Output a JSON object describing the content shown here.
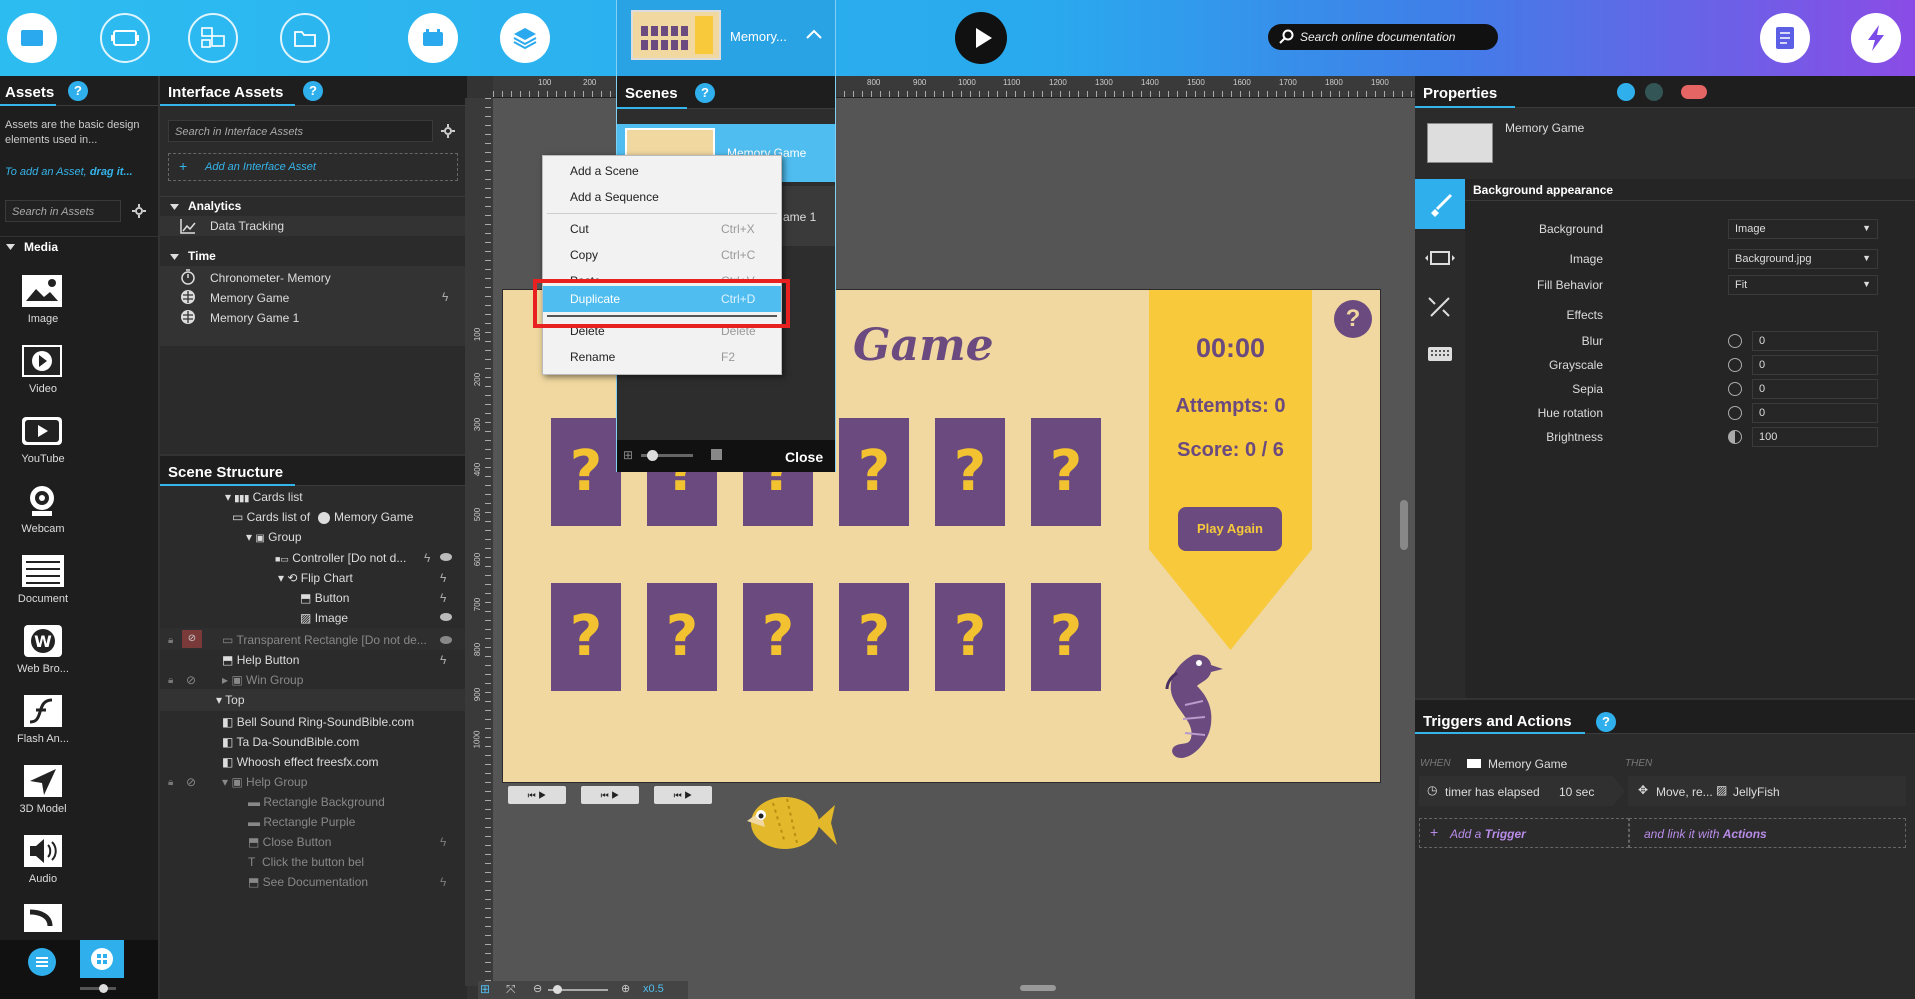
{
  "topbar": {
    "scene_selector_label": "Memory...",
    "doc_search_placeholder": "Search online documentation"
  },
  "assets": {
    "title": "Assets",
    "help": "?",
    "description": "Assets are the basic design elements used in...",
    "add_hint_prefix": "To add an Asset,",
    "add_hint_action": "drag it...",
    "search_placeholder": "Search in Assets",
    "media_group": "Media",
    "items": [
      "Image",
      "Video",
      "YouTube",
      "Webcam",
      "Document",
      "Web Bro...",
      "Flash An...",
      "3D Model",
      "Audio"
    ]
  },
  "interface_assets": {
    "title": "Interface Assets",
    "help": "?",
    "search_placeholder": "Search in Interface Assets",
    "add_label": "Add an Interface Asset",
    "groups": [
      {
        "name": "Analytics",
        "items": [
          "Data Tracking"
        ]
      },
      {
        "name": "Time",
        "items": [
          "Chronometer- Memory",
          "Memory Game",
          "Memory Game 1"
        ]
      }
    ]
  },
  "scene_structure": {
    "title": "Scene Structure",
    "rows": [
      "Cards list",
      "Cards list of",
      "Memory Game",
      "Group",
      "Controller [Do not d...",
      "Flip Chart",
      "Button",
      "Image",
      "Transparent Rectangle [Do not de...",
      "Help Button",
      "Win Group",
      "Top",
      "Bell Sound Ring-SoundBible.com",
      "Ta Da-SoundBible.com",
      "Whoosh effect freesfx.com",
      "Help Group",
      "Rectangle Background",
      "Rectangle Purple",
      "Close Button",
      "Click the button bel",
      "See Documentation"
    ]
  },
  "ruler_top": [
    "100",
    "200",
    "800",
    "900",
    "1000",
    "1100",
    "1200",
    "1300",
    "1400",
    "1500",
    "1600",
    "1700",
    "1800",
    "1900"
  ],
  "ruler_left": [
    "100",
    "200",
    "300",
    "400",
    "500",
    "600",
    "700",
    "800",
    "900",
    "1000"
  ],
  "scenes": {
    "title": "Scenes",
    "help": "?",
    "items": [
      "Memory Game",
      "Memory Game 1"
    ],
    "close_label": "Close"
  },
  "context_menu": {
    "items": [
      {
        "label": "Add a Scene",
        "shortcut": ""
      },
      {
        "label": "Add a Sequence",
        "shortcut": ""
      },
      {
        "label": "Cut",
        "shortcut": "Ctrl+X"
      },
      {
        "label": "Copy",
        "shortcut": "Ctrl+C"
      },
      {
        "label": "Paste",
        "shortcut": "Ctrl+V"
      },
      {
        "label": "Duplicate",
        "shortcut": "Ctrl+D"
      },
      {
        "label": "Delete",
        "shortcut": "Delete"
      },
      {
        "label": "Rename",
        "shortcut": "F2"
      }
    ]
  },
  "stage": {
    "title": "Game",
    "timer": "00:00",
    "attempts": "Attempts: 0",
    "score": "Score: 0 / 6",
    "play_again": "Play Again",
    "help": "?",
    "card_symbol": "?"
  },
  "bottom_bar": {
    "zoom": "x0.5"
  },
  "properties": {
    "title": "Properties",
    "object_name": "Memory Game",
    "section": "Background appearance",
    "fields": [
      {
        "label": "Background",
        "value": "Image"
      },
      {
        "label": "Image",
        "value": "Background.jpg"
      },
      {
        "label": "Fill Behavior",
        "value": "Fit"
      }
    ],
    "effects_label": "Effects",
    "effects": [
      {
        "label": "Blur",
        "value": "0"
      },
      {
        "label": "Grayscale",
        "value": "0"
      },
      {
        "label": "Sepia",
        "value": "0"
      },
      {
        "label": "Hue rotation",
        "value": "0"
      },
      {
        "label": "Brightness",
        "value": "100"
      }
    ]
  },
  "triggers": {
    "title": "Triggers and Actions",
    "help": "?",
    "when": "WHEN",
    "then": "THEN",
    "when_object": "Memory Game",
    "trigger": "timer has elapsed",
    "trigger_value": "10 sec",
    "action": "Move, re...",
    "action_target": "JellyFish",
    "add_trigger_prefix": "Add a",
    "add_trigger_word": "Trigger",
    "link_prefix": "and link it with",
    "link_word": "Actions"
  },
  "colors": {
    "accent": "#2fb0ec",
    "card": "#6a4a7f",
    "card_symbol": "#f2c230",
    "score_panel": "#f7c93b",
    "stage_bg": "#f0d8a0",
    "highlight_box": "#e8201f"
  }
}
